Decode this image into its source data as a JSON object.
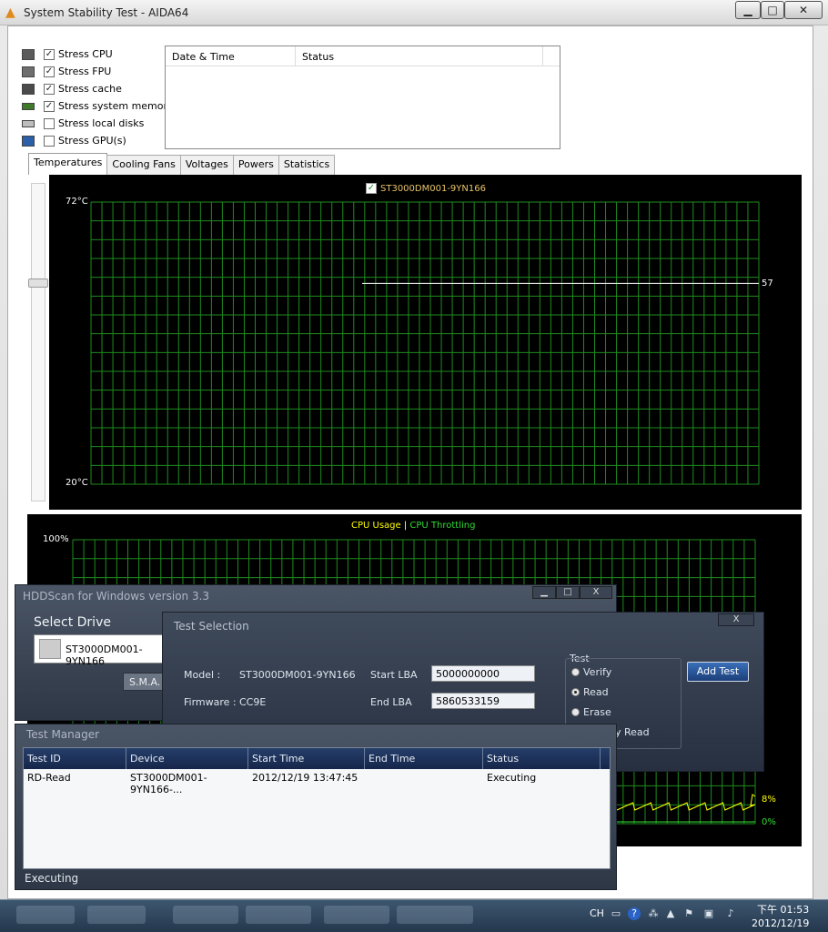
{
  "window": {
    "title": "System Stability Test - AIDA64",
    "min": "▁",
    "max": "□",
    "close": "✕"
  },
  "stress": [
    {
      "label": "Stress CPU",
      "checked": true,
      "icon": "cpu-icon"
    },
    {
      "label": "Stress FPU",
      "checked": true,
      "icon": "fpu-icon"
    },
    {
      "label": "Stress cache",
      "checked": true,
      "icon": "cache-icon"
    },
    {
      "label": "Stress system memory",
      "checked": true,
      "icon": "memory-icon"
    },
    {
      "label": "Stress local disks",
      "checked": false,
      "icon": "disk-icon"
    },
    {
      "label": "Stress GPU(s)",
      "checked": false,
      "icon": "gpu-icon"
    }
  ],
  "status_table": {
    "col1": "Date & Time",
    "col2": "Status"
  },
  "tabs": [
    "Temperatures",
    "Cooling Fans",
    "Voltages",
    "Powers",
    "Statistics"
  ],
  "temp_chart": {
    "legend": "ST3000DM001-9YN166",
    "ymax": "72°C",
    "ymin": "20°C",
    "current": "57",
    "value": 57,
    "range": [
      20,
      72
    ]
  },
  "cpu_chart": {
    "legend1": "CPU Usage",
    "legend_sep": "|",
    "legend2": "CPU Throttling",
    "ymax": "100%",
    "v1": "8%",
    "v2": "0%"
  },
  "hddscan": {
    "title": "HDDScan for Windows version 3.3",
    "select_drive": "Select Drive",
    "drive": "ST3000DM001-9YN166",
    "sma": "S.M.A.",
    "min": "▁",
    "max": "□",
    "close": "X"
  },
  "test_selection": {
    "title": "Test Selection",
    "close": "X",
    "model_label": "Model :",
    "model": "ST3000DM001-9YN166",
    "firmware_label": "Firmware :",
    "firmware": "CC9E",
    "start_lba_label": "Start LBA",
    "start_lba": "5000000000",
    "end_lba_label": "End LBA",
    "end_lba": "5860533159",
    "test_label": "Test",
    "options": [
      "Verify",
      "Read",
      "Erase"
    ],
    "selected": 1,
    "butterfly": "y Read",
    "add": "Add Test"
  },
  "test_manager": {
    "title": "Test Manager",
    "columns": [
      "Test ID",
      "Device",
      "Start Time",
      "End Time",
      "Status"
    ],
    "rows": [
      {
        "id": "RD-Read",
        "device": "ST3000DM001-9YN166-...",
        "start": "2012/12/19 13:47:45",
        "end": "",
        "status": "Executing"
      }
    ],
    "footer": "Executing"
  },
  "taskbar": {
    "lang": "CH",
    "time": "下午 01:53",
    "date": "2012/12/19"
  }
}
